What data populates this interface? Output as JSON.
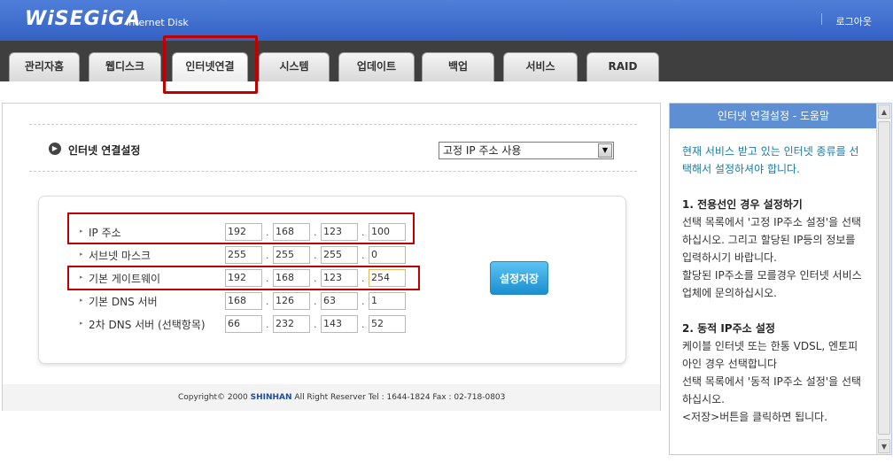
{
  "header": {
    "logo": "WiSEGiGA",
    "logo_sub": "Internet Disk",
    "logout": "로그아웃"
  },
  "tabs": [
    {
      "label": "관리자홈"
    },
    {
      "label": "웹디스크"
    },
    {
      "label": "인터넷연결",
      "active": true
    },
    {
      "label": "시스템"
    },
    {
      "label": "업데이트"
    },
    {
      "label": "백업"
    },
    {
      "label": "서비스"
    },
    {
      "label": "RAID"
    }
  ],
  "section": {
    "title": "인터넷 연결설정",
    "select_value": "고정 IP 주소 사용",
    "icon": "play-circle-icon"
  },
  "form": {
    "rows": [
      {
        "label": "IP 주소",
        "octets": [
          "192",
          "168",
          "123",
          "100"
        ]
      },
      {
        "label": "서브넷 마스크",
        "octets": [
          "255",
          "255",
          "255",
          "0"
        ]
      },
      {
        "label": "기본 게이트웨이",
        "octets": [
          "192",
          "168",
          "123",
          "254"
        ]
      },
      {
        "label": "기본 DNS 서버",
        "octets": [
          "168",
          "126",
          "63",
          "1"
        ]
      },
      {
        "label": "2차 DNS 서버 (선택항목)",
        "octets": [
          "66",
          "232",
          "143",
          "52"
        ]
      }
    ],
    "save_label": "설정저장"
  },
  "footer": {
    "pre": "Copyright© 2000 ",
    "brand": "SHINHAN",
    "post": " All Right Reserver Tel : 1644-1824 Fax : 02-718-0803"
  },
  "help": {
    "title": "인터넷 연결설정 - 도움말",
    "intro": "현재 서비스 받고 있는 인터넷 종류를 선택해서 설정하셔야 합니다.",
    "s1_title": "1. 전용선인 경우 설정하기",
    "s1_text1": "선택 목록에서 '고정 IP주소 설정'을 선택하십시오. 그리고 할당된 IP등의 정보를 입력하시기 바랍니다.",
    "s1_text2": "할당된 IP주소를 모를경우 인터넷 서비스 업체에 문의하십시오.",
    "s2_title": "2. 동적 IP주소 설정",
    "s2_text1": "케이블 인터넷 또는 한통 VDSL, 엔토피아인 경우 선택합니다",
    "s2_text2": "선택 목록에서 '동적 IP주소 설정'을 선택하십시오.",
    "s2_text3": "<저장>버튼을 클릭하면 됩니다."
  },
  "colors": {
    "header_blue": "#3561c4",
    "tabbar_dark": "#3f3f3f",
    "highlight_red": "#c00000",
    "help_head": "#5f8fd3",
    "save_button": "#1b8fd0"
  }
}
